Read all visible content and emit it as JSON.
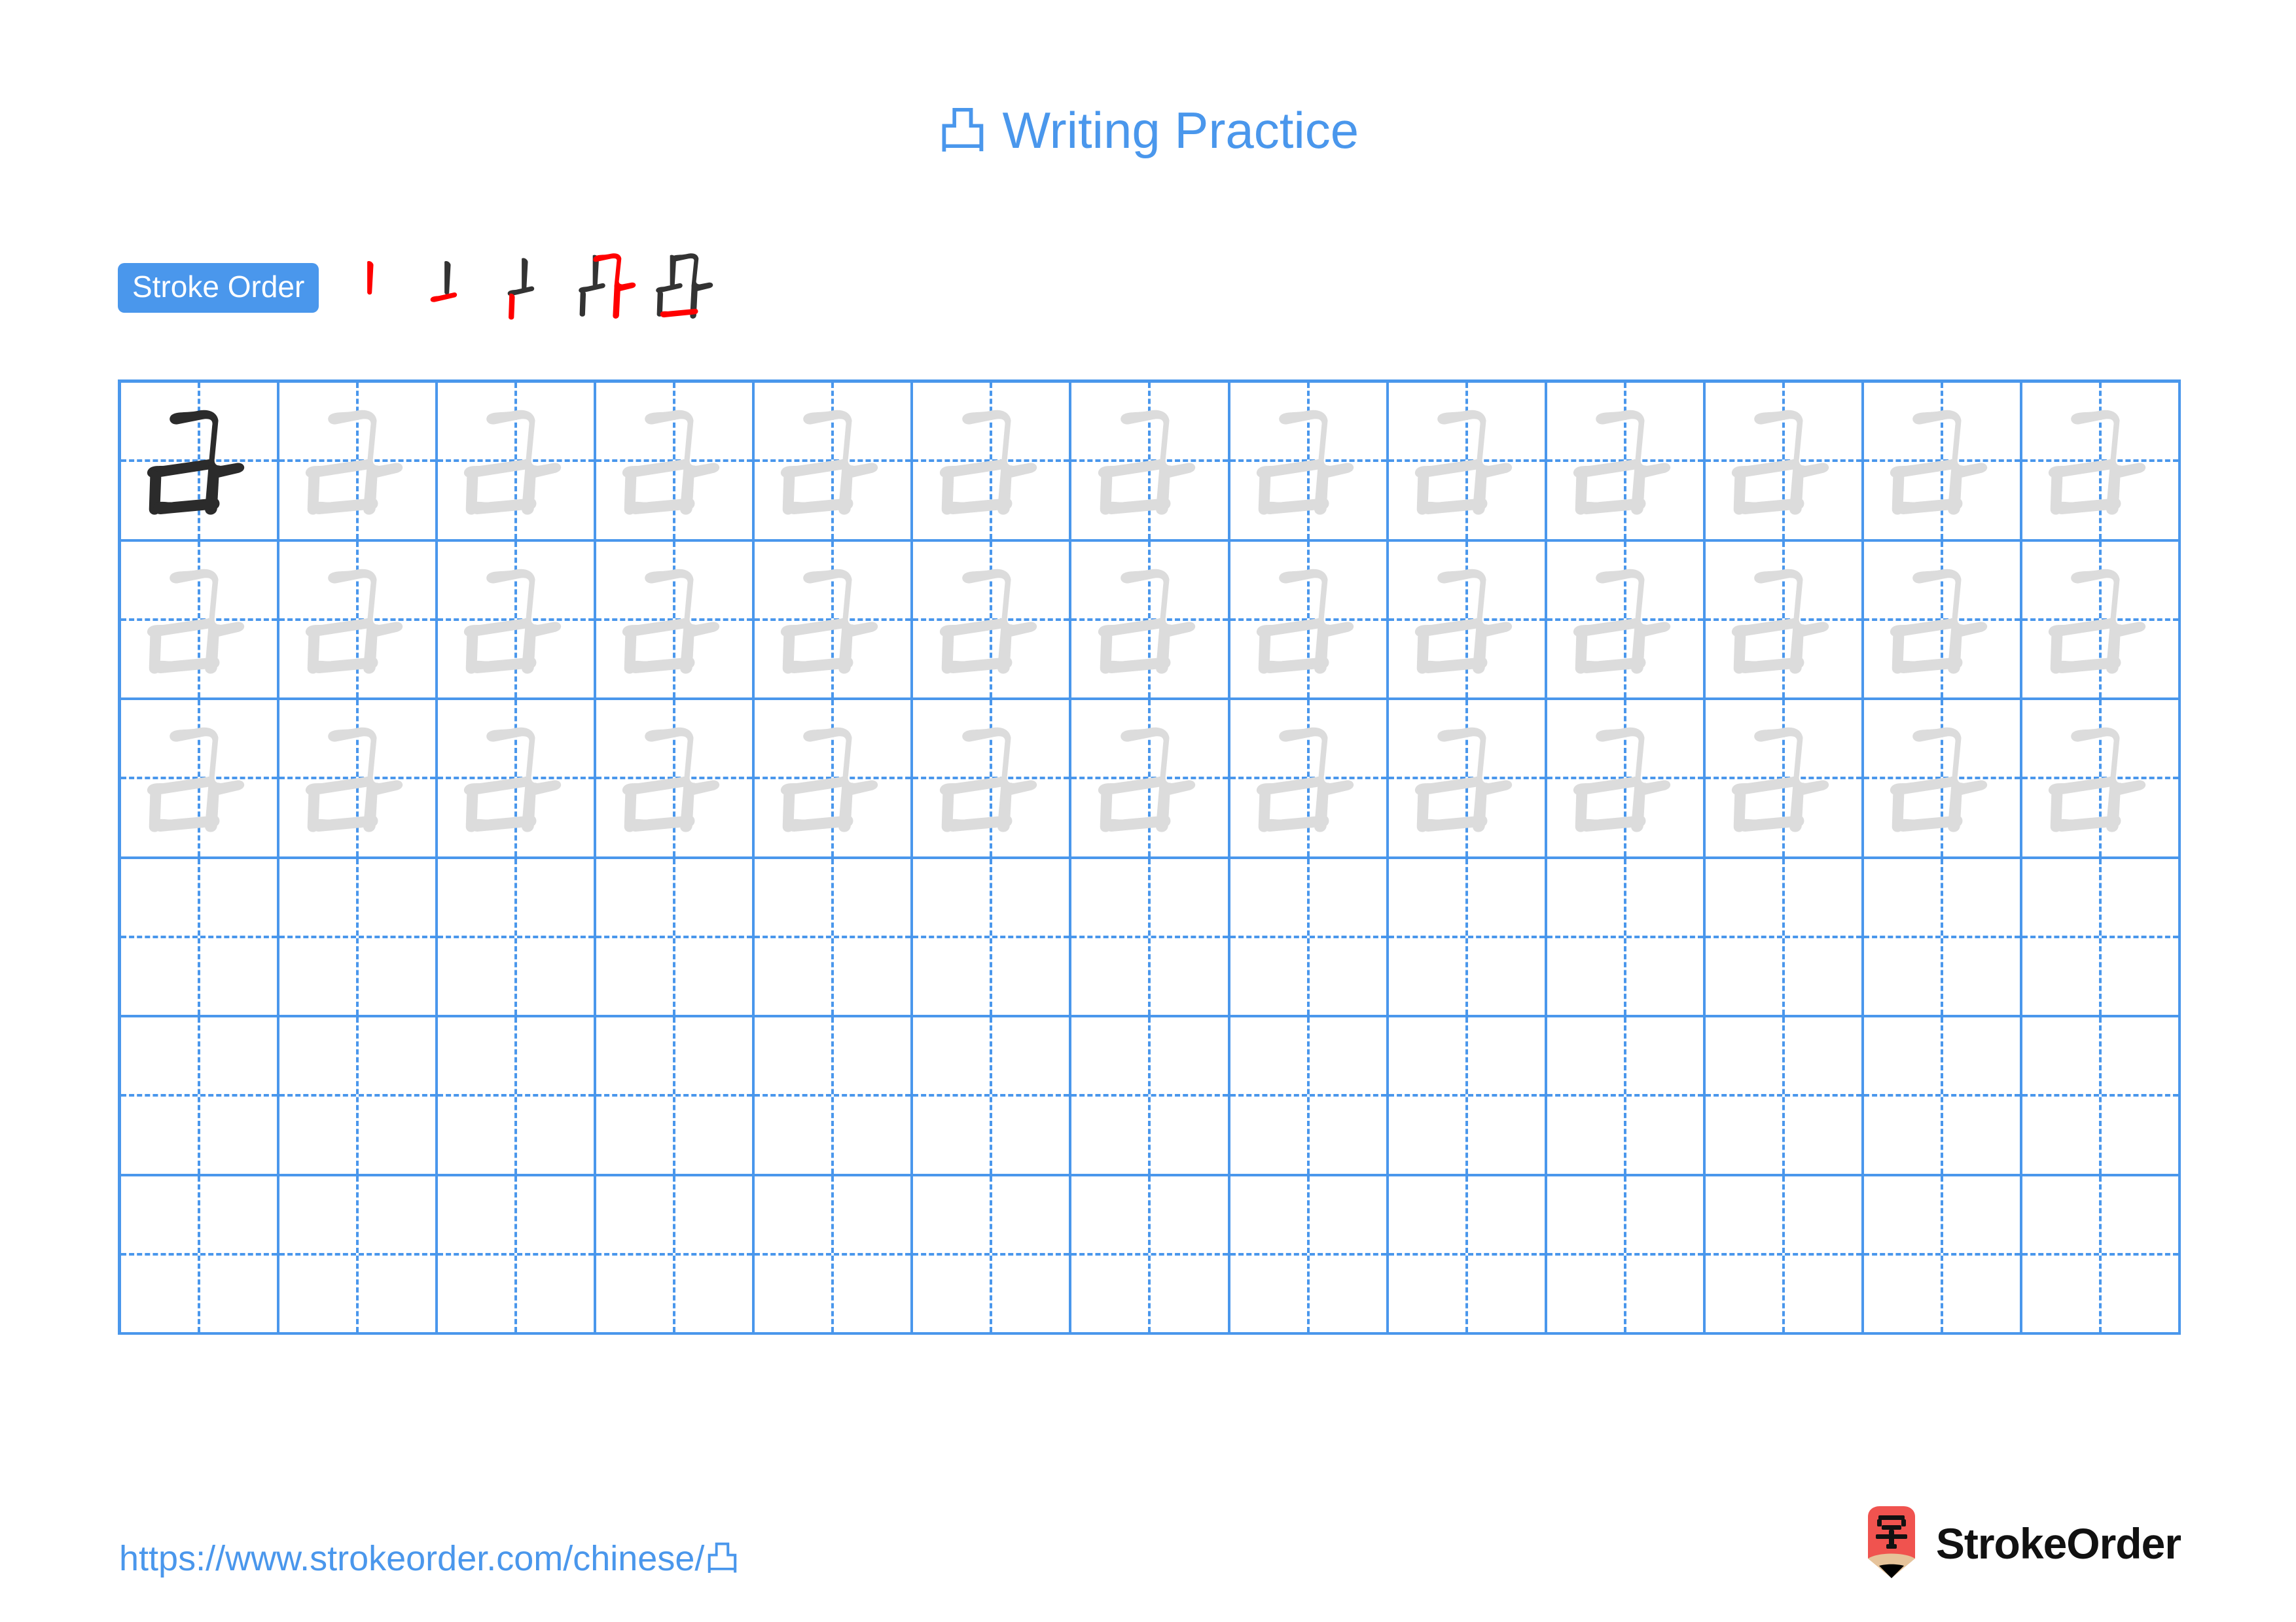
{
  "character": "凸",
  "title": {
    "character": "凸",
    "text": "Writing Practice",
    "full": "凸 Writing Practice",
    "color": "#4a97ec"
  },
  "stroke_order": {
    "label": "Stroke Order",
    "badge_bg": "#4a97ec",
    "badge_text_color": "#ffffff",
    "total_strokes": 5,
    "new_stroke_color": "#ff0000",
    "previous_stroke_color": "#333333",
    "steps": [
      {
        "index": 1,
        "new_stroke": "vertical",
        "strokes_shown": 1
      },
      {
        "index": 2,
        "new_stroke": "horizontal",
        "strokes_shown": 2
      },
      {
        "index": 3,
        "new_stroke": "vertical",
        "strokes_shown": 3
      },
      {
        "index": 4,
        "new_stroke": "horizontal-fold-vertical-hook",
        "strokes_shown": 4
      },
      {
        "index": 5,
        "new_stroke": "horizontal",
        "strokes_shown": 5
      }
    ]
  },
  "practice_grid": {
    "columns": 13,
    "rows": 6,
    "grid_line_color": "#4a97ec",
    "guide_line_style": "dashed",
    "example_color": "#2b2b2b",
    "trace_color": "#dcdcdc",
    "row_types": [
      "example-and-trace",
      "trace",
      "trace",
      "blank",
      "blank",
      "blank"
    ],
    "example_cell": {
      "row": 1,
      "column": 1,
      "character": "凸"
    }
  },
  "footer": {
    "url": "https://www.strokeorder.com/chinese/凸",
    "url_color": "#4a97ec",
    "brand": "StrokeOrder",
    "logo_character": "字",
    "logo_body_color": "#f0534f",
    "logo_band_color": "#e6c39a",
    "logo_tip_color": "#000000"
  }
}
